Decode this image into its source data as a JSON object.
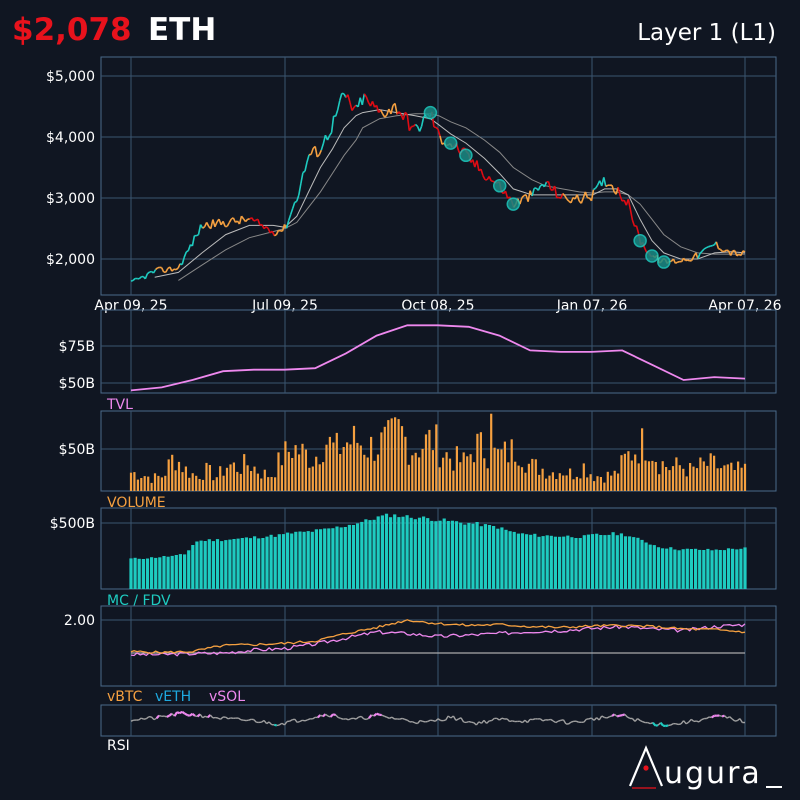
{
  "header": {
    "price": "$2,078",
    "ticker": "ETH",
    "category": "Layer 1 (L1)"
  },
  "brand": {
    "name": "ugura"
  },
  "colors": {
    "background": "#101622",
    "panel_border": "#4a6a8a",
    "grid": "#3a5570",
    "up": "#1ecbc0",
    "down": "#e00c14",
    "neutral": "#f5a040",
    "tvl": "#ee88ee",
    "volume": "#f5a040",
    "mc": "#1ecbc0",
    "vbtc": "#f5a040",
    "veth": "#1ea9e0",
    "vsol": "#ee88ee",
    "rsi": "#a0a0a0",
    "ma": "#888888",
    "price_red": "#e8121c"
  },
  "chart_data": [
    {
      "type": "line",
      "id": "price",
      "x_ticks": [
        "Apr 09, 25",
        "Jul 09, 25",
        "Oct 08, 25",
        "Jan 07, 26",
        "Apr 07, 26"
      ],
      "y_ticks": [
        "$2,000",
        "$3,000",
        "$4,000",
        "$5,000"
      ],
      "ylim": [
        1500,
        5300
      ],
      "x": [
        "2025-04-09",
        "2025-04-23",
        "2025-05-07",
        "2025-05-21",
        "2025-06-04",
        "2025-06-18",
        "2025-07-02",
        "2025-07-09",
        "2025-07-16",
        "2025-07-23",
        "2025-07-30",
        "2025-08-06",
        "2025-08-13",
        "2025-08-20",
        "2025-08-24",
        "2025-09-03",
        "2025-09-13",
        "2025-09-24",
        "2025-10-03",
        "2025-10-08",
        "2025-10-15",
        "2025-10-24",
        "2025-11-04",
        "2025-11-13",
        "2025-11-21",
        "2025-12-02",
        "2025-12-10",
        "2025-12-20",
        "2025-12-30",
        "2026-01-07",
        "2026-01-14",
        "2026-01-21",
        "2026-01-28",
        "2026-02-04",
        "2026-02-11",
        "2026-02-18",
        "2026-02-28",
        "2026-03-10",
        "2026-03-20",
        "2026-03-30",
        "2026-04-07"
      ],
      "values": [
        1600,
        1800,
        1850,
        2550,
        2600,
        2650,
        2450,
        2500,
        3000,
        3700,
        3800,
        4200,
        4700,
        4400,
        4650,
        4400,
        4500,
        4100,
        4400,
        4000,
        3900,
        3700,
        3400,
        3200,
        2900,
        3050,
        3250,
        3000,
        2980,
        3050,
        3300,
        3150,
        2900,
        2300,
        2050,
        1950,
        1980,
        2050,
        2250,
        2100,
        2078
      ],
      "ma_fast": [
        null,
        1700,
        1780,
        2100,
        2400,
        2550,
        2550,
        2520,
        2700,
        3100,
        3500,
        3800,
        4150,
        4350,
        4400,
        4450,
        4400,
        4350,
        4300,
        4200,
        4050,
        3900,
        3650,
        3400,
        3150,
        3050,
        3050,
        3050,
        3050,
        3050,
        3150,
        3150,
        3050,
        2650,
        2300,
        2100,
        2000,
        2000,
        2100,
        2120,
        2100
      ],
      "ma_slow": [
        null,
        null,
        1650,
        1900,
        2150,
        2350,
        2450,
        2500,
        2600,
        2850,
        3100,
        3400,
        3700,
        3950,
        4150,
        4300,
        4350,
        4380,
        4380,
        4350,
        4250,
        4150,
        3950,
        3750,
        3500,
        3300,
        3200,
        3150,
        3100,
        3080,
        3100,
        3100,
        3050,
        2900,
        2650,
        2400,
        2200,
        2100,
        2080,
        2080,
        2080
      ]
    },
    {
      "type": "area",
      "id": "tvl",
      "series": [
        {
          "name": "TVL"
        }
      ],
      "y_ticks": [
        "$50B",
        "$75B"
      ],
      "ylim": [
        45,
        95
      ],
      "x_frac": [
        0,
        0.05,
        0.1,
        0.15,
        0.2,
        0.25,
        0.3,
        0.35,
        0.4,
        0.45,
        0.5,
        0.55,
        0.6,
        0.65,
        0.7,
        0.75,
        0.8,
        0.85,
        0.9,
        0.95,
        1
      ],
      "values": [
        45,
        47,
        52,
        58,
        59,
        59,
        60,
        70,
        82,
        89,
        89,
        88,
        82,
        72,
        71,
        71,
        72,
        62,
        52,
        54,
        53
      ]
    },
    {
      "type": "bar",
      "id": "volume",
      "series": [
        {
          "name": "VOLUME"
        }
      ],
      "y_ticks": [
        "$50B"
      ],
      "ylim": [
        0,
        100
      ],
      "values": [
        22,
        20,
        15,
        18,
        42,
        26,
        18,
        24,
        17,
        31,
        28,
        33,
        22,
        18,
        40,
        52,
        45,
        38,
        62,
        48,
        58,
        60,
        52,
        55,
        60,
        72,
        50,
        55,
        62,
        45,
        38,
        34,
        55,
        48,
        42,
        45,
        52,
        30,
        28,
        22,
        25,
        20,
        30,
        18,
        18,
        20,
        40,
        52,
        60,
        35,
        28,
        30,
        24,
        30,
        32,
        26,
        24,
        25
      ]
    },
    {
      "type": "bar",
      "id": "mc_fdv",
      "series": [
        {
          "name": "MC / FDV"
        }
      ],
      "y_ticks": [
        "$500B"
      ],
      "ylim": [
        0,
        650
      ],
      "values": [
        230,
        232,
        238,
        245,
        250,
        262,
        360,
        370,
        372,
        375,
        380,
        388,
        395,
        402,
        410,
        425,
        430,
        440,
        450,
        465,
        480,
        500,
        520,
        545,
        560,
        555,
        545,
        540,
        530,
        520,
        510,
        500,
        495,
        480,
        470,
        440,
        420,
        410,
        405,
        402,
        400,
        398,
        395,
        410,
        412,
        420,
        410,
        380,
        350,
        320,
        310,
        300,
        300,
        298,
        295,
        300,
        305,
        308
      ]
    },
    {
      "type": "line",
      "id": "relative",
      "series": [
        {
          "name": "vBTC"
        },
        {
          "name": "vETH"
        },
        {
          "name": "vSOL"
        }
      ],
      "y_ticks": [
        "2.00"
      ],
      "ylim": [
        0.3,
        2.2
      ],
      "x_frac": [
        0,
        0.05,
        0.1,
        0.15,
        0.2,
        0.25,
        0.3,
        0.35,
        0.4,
        0.45,
        0.5,
        0.55,
        0.6,
        0.65,
        0.7,
        0.75,
        0.8,
        0.85,
        0.9,
        0.95,
        1
      ],
      "vbtc": [
        0.95,
        0.92,
        0.95,
        1.15,
        1.18,
        1.22,
        1.3,
        1.55,
        1.75,
        2.0,
        1.88,
        1.82,
        1.85,
        1.78,
        1.75,
        1.8,
        1.82,
        1.78,
        1.7,
        1.68,
        1.6
      ],
      "veth": [
        0.9,
        0.9,
        0.9,
        0.9,
        0.9,
        0.9,
        0.9,
        0.9,
        0.9,
        0.9,
        0.9,
        0.9,
        0.9,
        0.9,
        0.9,
        0.9,
        0.9,
        0.9,
        0.9,
        0.9,
        0.9
      ],
      "vsol": [
        0.85,
        0.85,
        0.88,
        0.9,
        1.0,
        1.05,
        1.2,
        1.4,
        1.6,
        1.55,
        1.45,
        1.5,
        1.55,
        1.62,
        1.65,
        1.72,
        1.78,
        1.7,
        1.65,
        1.78,
        1.85
      ]
    },
    {
      "type": "line",
      "id": "rsi",
      "series": [
        {
          "name": "RSI"
        }
      ],
      "ylim": [
        0,
        100
      ],
      "x_frac": [
        0,
        0.04,
        0.08,
        0.12,
        0.16,
        0.2,
        0.24,
        0.28,
        0.32,
        0.36,
        0.4,
        0.44,
        0.48,
        0.52,
        0.56,
        0.6,
        0.64,
        0.68,
        0.72,
        0.76,
        0.8,
        0.84,
        0.88,
        0.92,
        0.96,
        1
      ],
      "values": [
        55,
        60,
        80,
        70,
        55,
        50,
        35,
        55,
        78,
        52,
        72,
        55,
        40,
        65,
        38,
        55,
        48,
        52,
        40,
        60,
        72,
        38,
        32,
        50,
        68,
        45
      ]
    }
  ]
}
